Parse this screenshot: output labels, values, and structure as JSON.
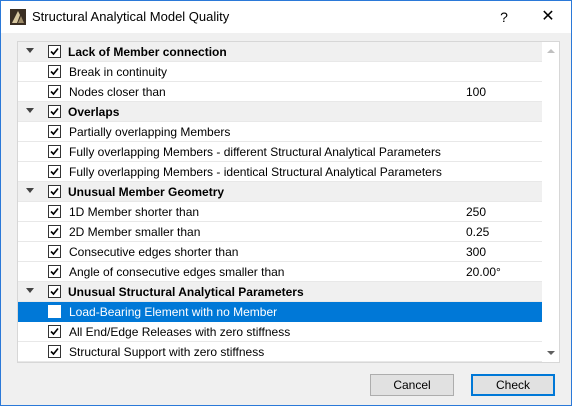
{
  "window": {
    "title": "Structural Analytical Model Quality",
    "help_label": "?",
    "close_label": "✕"
  },
  "groups": [
    {
      "label": "Lack of Member connection",
      "checked": true,
      "items": [
        {
          "label": "Break in continuity",
          "value": "",
          "checked": true
        },
        {
          "label": "Nodes closer than",
          "value": "100",
          "checked": true
        }
      ]
    },
    {
      "label": "Overlaps",
      "checked": true,
      "items": [
        {
          "label": "Partially overlapping Members",
          "value": "",
          "checked": true
        },
        {
          "label": "Fully overlapping Members - different Structural Analytical Parameters",
          "value": "",
          "checked": true
        },
        {
          "label": "Fully overlapping Members - identical Structural Analytical Parameters",
          "value": "",
          "checked": true
        }
      ]
    },
    {
      "label": "Unusual Member Geometry",
      "checked": true,
      "items": [
        {
          "label": "1D Member shorter than",
          "value": "250",
          "checked": true
        },
        {
          "label": "2D Member smaller than",
          "value": "0.25",
          "checked": true
        },
        {
          "label": "Consecutive edges shorter than",
          "value": "300",
          "checked": true
        },
        {
          "label": "Angle of consecutive edges smaller than",
          "value": "20.00°",
          "checked": true
        }
      ]
    },
    {
      "label": "Unusual Structural Analytical Parameters",
      "checked": true,
      "items": [
        {
          "label": "Load-Bearing Element with no Member",
          "value": "",
          "checked": true,
          "selected": true
        },
        {
          "label": "All End/Edge Releases with zero stiffness",
          "value": "",
          "checked": true
        },
        {
          "label": "Structural Support with zero stiffness",
          "value": "",
          "checked": true
        }
      ]
    }
  ],
  "buttons": {
    "cancel": "Cancel",
    "check": "Check"
  },
  "colors": {
    "selection": "#0078d7",
    "group_bg": "#f0f0f0",
    "dialog_bg": "#f0f0f0"
  }
}
